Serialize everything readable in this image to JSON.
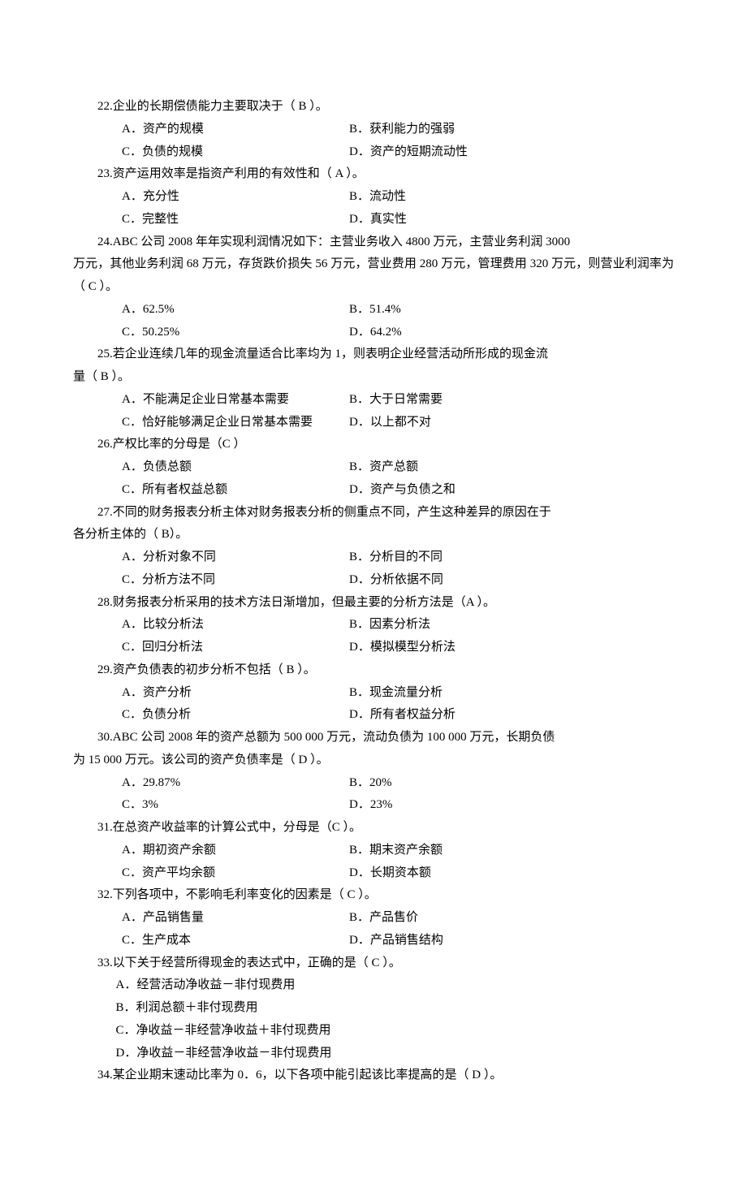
{
  "q22": {
    "stem": "22.企业的长期偿债能力主要取决于（  B  ）。",
    "A": "A．资产的规模",
    "B": "B．获利能力的强弱",
    "C": "C．负债的规模",
    "D": "D．资产的短期流动性"
  },
  "q23": {
    "stem": "23.资产运用效率是指资产利用的有效性和（ A   ）。",
    "A": "A．充分性",
    "B": "B．流动性",
    "C": "C．完整性",
    "D": "D．真实性"
  },
  "q24": {
    "stem_a": "24.ABC 公司 2008 年年实现利润情况如下：主营业务收入 4800 万元，主营业务利润 3000",
    "stem_b": "万元，其他业务利润 68 万元，存货跌价损失 56 万元，营业费用 280 万元，管理费用 320 万元，则营业利润率为（ C   ）。",
    "A": "A．62.5%",
    "B": "B．51.4%",
    "C": "C．50.25%",
    "D": "D．64.2%"
  },
  "q25": {
    "stem_a": "25.若企业连续几年的现金流量适合比率均为 1，则表明企业经营活动所形成的现金流",
    "stem_b": "量（ B   ）。",
    "A": "A．不能满足企业日常基本需要",
    "B": "B．大于日常需要",
    "C": "C．恰好能够满足企业日常基本需要",
    "D": "D．以上都不对"
  },
  "q26": {
    "stem": "26.产权比率的分母是（C    ）",
    "A": "A．负债总额",
    "B": "B．资产总额",
    "C": "C．所有者权益总额",
    "D": "D．资产与负债之和"
  },
  "q27": {
    "stem_a": "27.不同的财务报表分析主体对财务报表分析的侧重点不同，产生这种差异的原因在于",
    "stem_b": "各分析主体的（  B）。",
    "A": "A．分析对象不同",
    "B": "B．分析目的不同",
    "C": "C．分析方法不同",
    "D": "D．分析依据不同"
  },
  "q28": {
    "stem": "28.财务报表分析采用的技术方法日渐增加，但最主要的分析方法是（A    ）。",
    "A": "A．比较分析法",
    "B": "B．因素分析法",
    "C": "C．回归分析法",
    "D": "D．模拟模型分析法"
  },
  "q29": {
    "stem": "29.资产负债表的初步分析不包括（   B ）。",
    "A": "A．资产分析",
    "B": "B．现金流量分析",
    "C": "C．负债分析",
    "D": "D．所有者权益分析"
  },
  "q30": {
    "stem_a": "30.ABC 公司 2008 年的资产总额为 500 000 万元，流动负债为 100 000 万元，长期负债",
    "stem_b": "为 15 000 万元。该公司的资产负债率是（ D   ）。",
    "A": "A．29.87%",
    "B": "B．20%",
    "C": "C．3%",
    "D": "D．23%"
  },
  "q31": {
    "stem": "31.在总资产收益率的计算公式中，分母是（C    ）。",
    "A": "A．期初资产余额",
    "B": "B．期末资产余额",
    "C": "C．资产平均余额",
    "D": "D．长期资本额"
  },
  "q32": {
    "stem": "32.下列各项中，不影响毛利率变化的因素是（  C  ）。",
    "A": "A．产品销售量",
    "B": "B．产品售价",
    "C": "C．生产成本",
    "D": "D．产品销售结构"
  },
  "q33": {
    "stem": "33.以下关于经营所得现金的表达式中，正确的是（ C ）。",
    "A": "A．经营活动净收益－非付现费用",
    "B": "B．利润总额＋非付现费用",
    "C": "C．净收益－非经营净收益＋非付现费用",
    "D": "D．净收益－非经营净收益－非付现费用"
  },
  "q34": {
    "stem": "34.某企业期末速动比率为 0．6，以下各项中能引起该比率提高的是（  D   ）。"
  }
}
